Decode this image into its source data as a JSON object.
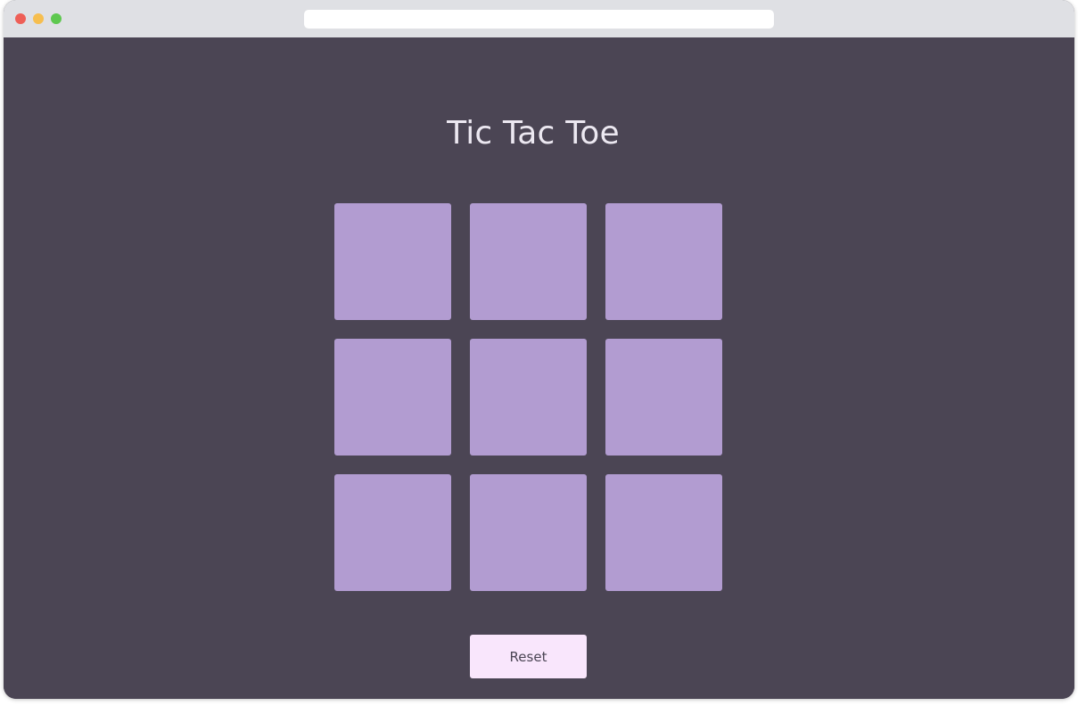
{
  "browser": {
    "address_value": ""
  },
  "main": {
    "title": "Tic Tac Toe",
    "board": {
      "cells": [
        "",
        "",
        "",
        "",
        "",
        "",
        "",
        "",
        ""
      ]
    },
    "reset_label": "Reset"
  },
  "colors": {
    "background": "#4b4554",
    "cell": "#b29cd1",
    "button": "#f9e6fc",
    "title_text": "#ece8f1"
  }
}
